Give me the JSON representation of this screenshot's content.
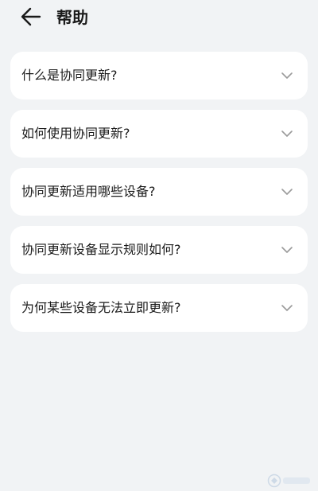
{
  "header": {
    "title": "帮助",
    "back_icon": "arrow-left-icon"
  },
  "faq": {
    "items": [
      {
        "label": "什么是协同更新?"
      },
      {
        "label": "如何使用协同更新?"
      },
      {
        "label": "协同更新适用哪些设备?"
      },
      {
        "label": "协同更新设备显示规则如何?"
      },
      {
        "label": "为何某些设备无法立即更新?"
      }
    ],
    "chevron_icon": "chevron-down-icon"
  },
  "colors": {
    "background": "#f1f3f5",
    "card": "#ffffff",
    "text": "#1a1a1a",
    "icon": "#9a9a9a"
  }
}
